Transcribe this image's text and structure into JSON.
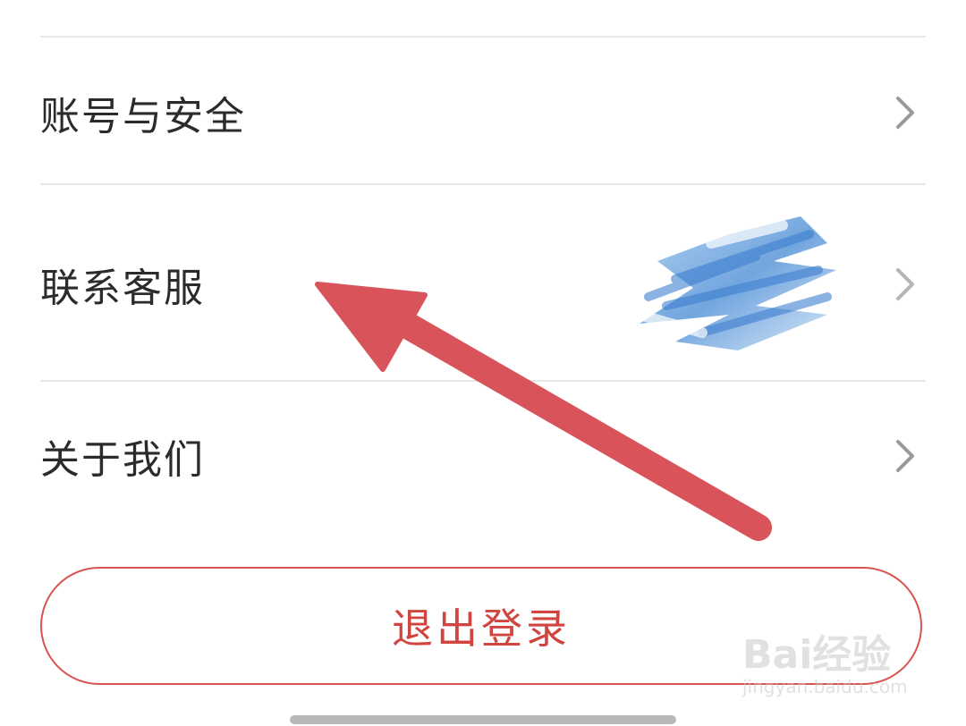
{
  "menu": {
    "items": [
      {
        "label": "账号与安全"
      },
      {
        "label": "联系客服"
      },
      {
        "label": "关于我们"
      }
    ],
    "chevron_icon": "chevron-right-icon"
  },
  "logout": {
    "label": "退出登录"
  },
  "annotation": {
    "arrow_color": "#d9535a"
  },
  "watermark": {
    "brand": "Bai经验",
    "url": "jingyan.baidu.com"
  },
  "colors": {
    "accent": "#d0453f",
    "divider": "#e8e8e8",
    "text": "#2b2b2b"
  }
}
